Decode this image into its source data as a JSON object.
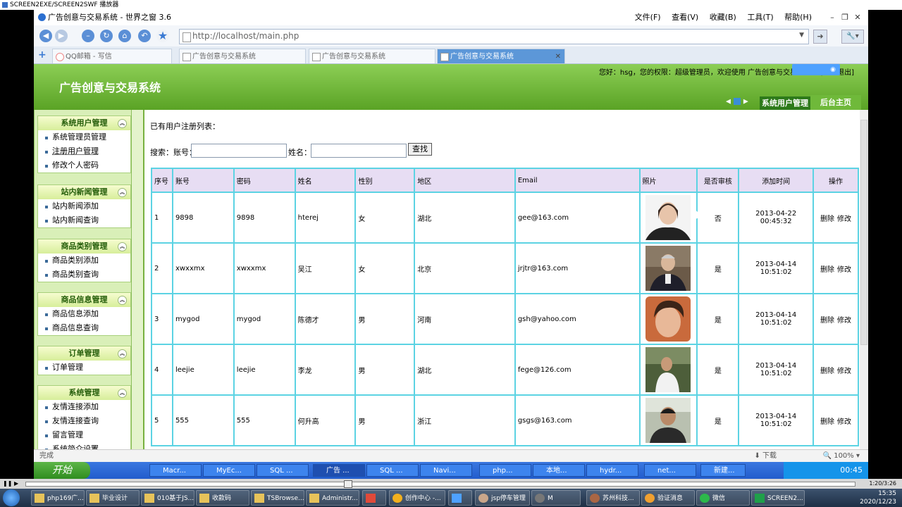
{
  "recorder": {
    "title": "SCREEN2EXE/SCREEN2SWF 播放器"
  },
  "browser": {
    "title": "广告创意与交易系统 - 世界之窗 3.6",
    "menu": [
      "文件(F)",
      "查看(V)",
      "收藏(B)",
      "工具(T)",
      "帮助(H)"
    ],
    "address": "http://localhost/main.php",
    "tabs": [
      {
        "label": "QQ邮箱 - 写信",
        "active": false
      },
      {
        "label": "广告创意与交易系统",
        "active": false
      },
      {
        "label": "广告创意与交易系统",
        "active": false
      },
      {
        "label": "广告创意与交易系统",
        "active": true
      }
    ],
    "status": "完成",
    "download": "下载",
    "zoom": "100%"
  },
  "header": {
    "system_name": "广告创意与交易系统",
    "welcome": "您好：hsg，您的权限：超级管理员，欢迎使用 广告创意与交易系统！ [注销退出]",
    "btn_user_mgmt": "系统用户管理",
    "btn_home": "后台主页"
  },
  "sidebar": {
    "groups": [
      {
        "title": "系统用户管理",
        "items": [
          "系统管理员管理",
          "注册用户管理",
          "修改个人密码"
        ]
      },
      {
        "title": "站内新闻管理",
        "items": [
          "站内新闻添加",
          "站内新闻查询"
        ]
      },
      {
        "title": "商品类别管理",
        "items": [
          "商品类别添加",
          "商品类别查询"
        ]
      },
      {
        "title": "商品信息管理",
        "items": [
          "商品信息添加",
          "商品信息查询"
        ]
      },
      {
        "title": "订单管理",
        "items": [
          "订单管理"
        ]
      },
      {
        "title": "系统管理",
        "items": [
          "友情连接添加",
          "友情连接查询",
          "留言管理",
          "系统简介设置"
        ]
      }
    ]
  },
  "main": {
    "heading": "已有用户注册列表：",
    "search_account_label": "搜索：账号：",
    "search_name_label": "姓名：",
    "search_button": "查找",
    "columns": [
      "序号",
      "账号",
      "密码",
      "姓名",
      "性别",
      "地区",
      "Email",
      "照片",
      "是否审核",
      "添加时间",
      "操作"
    ],
    "rows": [
      {
        "no": "1",
        "account": "9898",
        "password": "9898",
        "name": "hterej",
        "gender": "女",
        "region": "湖北",
        "email": "gee@163.com",
        "approved": "否",
        "added": "2013-04-22 00:45:32"
      },
      {
        "no": "2",
        "account": "xwxxmx",
        "password": "xwxxmx",
        "name": "吴江",
        "gender": "女",
        "region": "北京",
        "email": "jrjtr@163.com",
        "approved": "是",
        "added": "2013-04-14 10:51:02"
      },
      {
        "no": "3",
        "account": "mygod",
        "password": "mygod",
        "name": "陈德才",
        "gender": "男",
        "region": "河南",
        "email": "gsh@yahoo.com",
        "approved": "是",
        "added": "2013-04-14 10:51:02"
      },
      {
        "no": "4",
        "account": "leejie",
        "password": "leejie",
        "name": "李龙",
        "gender": "男",
        "region": "湖北",
        "email": "fege@126.com",
        "approved": "是",
        "added": "2013-04-14 10:51:02"
      },
      {
        "no": "5",
        "account": "555",
        "password": "555",
        "name": "何升高",
        "gender": "男",
        "region": "浙江",
        "email": "gsgs@163.com",
        "approved": "是",
        "added": "2013-04-14 10:51:02"
      }
    ],
    "delete_label": "删除",
    "edit_label": "修改"
  },
  "xp_taskbar": {
    "start": "开始",
    "tasks": [
      "Macr...",
      "MyEc...",
      "SQL ...",
      "广告 ...",
      "SQL ...",
      "Navi...",
      "php...",
      "本地...",
      "hydr...",
      "net...",
      "新建..."
    ],
    "time": "00:45"
  },
  "player": {
    "time": "1:20/3:26"
  },
  "w7_taskbar": {
    "tasks": [
      "php169广...",
      "毕业设计",
      "010基于JS...",
      "收款码",
      "TSBrowse...",
      "Administr...",
      "",
      "创作中心 -...",
      "",
      "jsp停车管理",
      "M",
      "苏州科技...",
      "验证消息",
      "微信",
      "SCREEN2..."
    ],
    "time": "15:35",
    "date": "2020/12/23"
  }
}
